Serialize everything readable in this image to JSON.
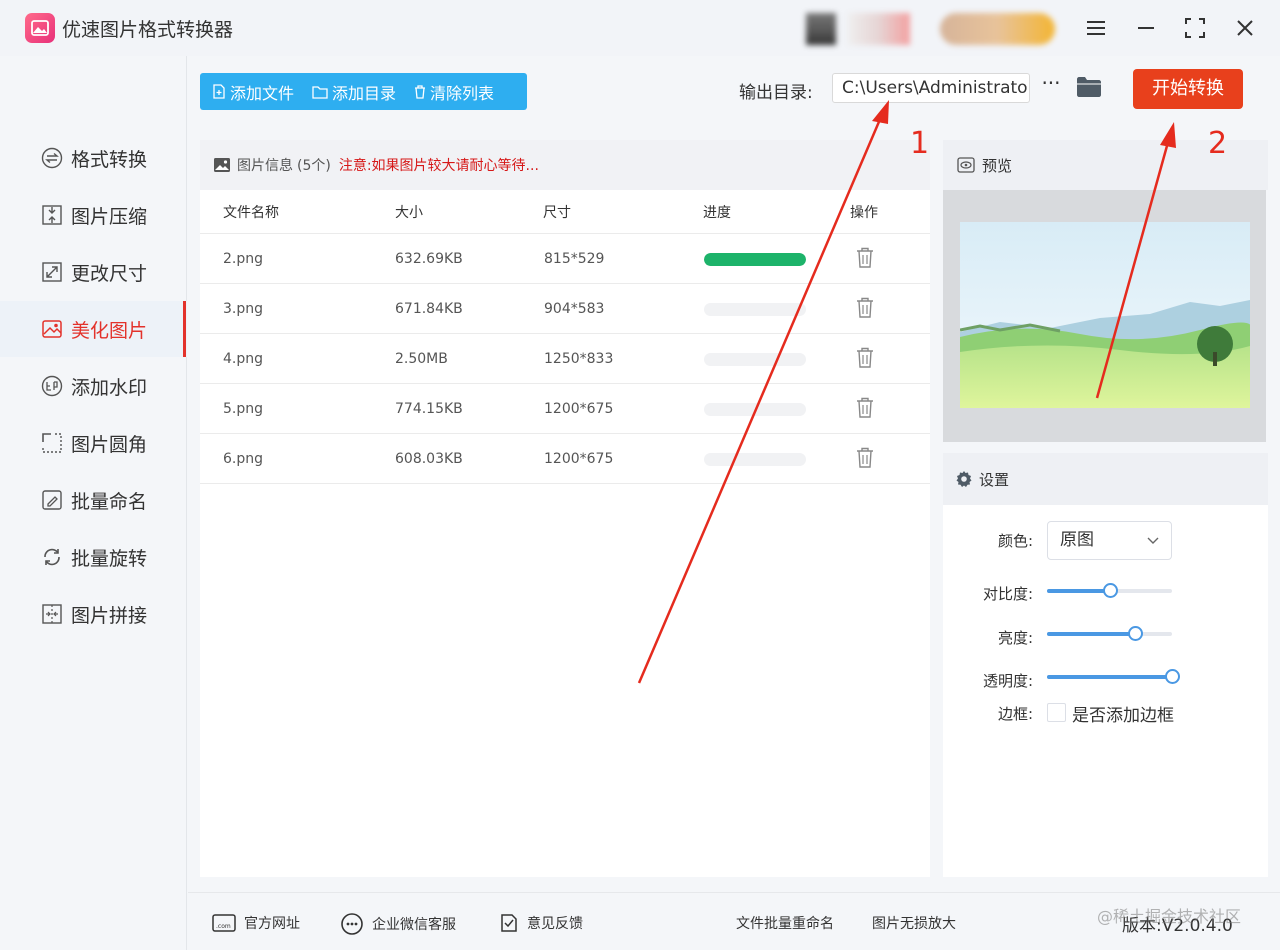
{
  "app": {
    "title": "优速图片格式转换器",
    "window_controls": [
      "menu-icon",
      "minimize-icon",
      "maximize-icon",
      "close-icon"
    ]
  },
  "sidebar": {
    "items": [
      {
        "label": "格式转换",
        "icon": "format-convert-icon",
        "active": false
      },
      {
        "label": "图片压缩",
        "icon": "compress-icon",
        "active": false
      },
      {
        "label": "更改尺寸",
        "icon": "resize-icon",
        "active": false
      },
      {
        "label": "美化图片",
        "icon": "beautify-icon",
        "active": true
      },
      {
        "label": "添加水印",
        "icon": "watermark-icon",
        "active": false
      },
      {
        "label": "图片圆角",
        "icon": "round-corner-icon",
        "active": false
      },
      {
        "label": "批量命名",
        "icon": "rename-icon",
        "active": false
      },
      {
        "label": "批量旋转",
        "icon": "rotate-icon",
        "active": false
      },
      {
        "label": "图片拼接",
        "icon": "stitch-icon",
        "active": false
      }
    ]
  },
  "toolbar": {
    "add_file": "添加文件",
    "add_dir": "添加目录",
    "clear_list": "清除列表",
    "output_label": "输出目录:",
    "output_path": "C:\\Users\\Administrator\\",
    "more": "···",
    "start": "开始转换"
  },
  "file_panel": {
    "title": "图片信息",
    "count": "(5个)",
    "notice": "注意:如果图片较大请耐心等待...",
    "columns": [
      "文件名称",
      "大小",
      "尺寸",
      "进度",
      "操作"
    ],
    "rows": [
      {
        "name": "2.png",
        "size": "632.69KB",
        "dims": "815*529",
        "progress": 1.0
      },
      {
        "name": "3.png",
        "size": "671.84KB",
        "dims": "904*583",
        "progress": 0
      },
      {
        "name": "4.png",
        "size": "2.50MB",
        "dims": "1250*833",
        "progress": 0
      },
      {
        "name": "5.png",
        "size": "774.15KB",
        "dims": "1200*675",
        "progress": 0
      },
      {
        "name": "6.png",
        "size": "608.03KB",
        "dims": "1200*675",
        "progress": 0
      }
    ]
  },
  "preview": {
    "title": "预览"
  },
  "settings": {
    "title": "设置",
    "color_label": "颜色:",
    "color_value": "原图",
    "contrast_label": "对比度:",
    "contrast_value": 0.5,
    "brightness_label": "亮度:",
    "brightness_value": 0.7,
    "opacity_label": "透明度:",
    "opacity_value": 1.0,
    "border_label": "边框:",
    "border_checkbox_label": "是否添加边框",
    "border_checked": false
  },
  "footer": {
    "website": "官方网址",
    "wechat": "企业微信客服",
    "feedback": "意见反馈",
    "batch_rename": "文件批量重命名",
    "lossless": "图片无损放大",
    "version": "版本:V2.0.4.0"
  },
  "annotations": {
    "num1": "1",
    "num2": "2",
    "watermark": "@稀土掘金技术社区"
  },
  "colors": {
    "accent_blue": "#2eaef0",
    "start_red": "#e8401c",
    "active_red": "#e3322b",
    "progress_green": "#1db36a",
    "slider_blue": "#4a98e3",
    "arrow_red": "#e52b1e"
  }
}
